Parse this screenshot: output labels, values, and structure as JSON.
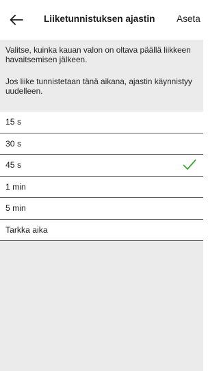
{
  "header": {
    "back_icon": "arrow-left-icon",
    "title": "Liiketunnistuksen ajastin",
    "set_label": "Aseta"
  },
  "description": {
    "line1": "Valitse, kuinka kauan valon on oltava päällä liikkeen havaitsemisen jälkeen.",
    "line2": "Jos liike tunnistetaan tänä aikana, ajastin käynnistyy uudelleen."
  },
  "options": [
    {
      "label": "15 s",
      "selected": false
    },
    {
      "label": "30 s",
      "selected": false
    },
    {
      "label": "45 s",
      "selected": true
    },
    {
      "label": "1 min",
      "selected": false
    },
    {
      "label": "5 min",
      "selected": false
    },
    {
      "label": "Tarkka aika",
      "selected": false
    }
  ],
  "colors": {
    "check": "#3aa735",
    "background_gray": "#ebebeb",
    "divider": "#5c5c5c"
  }
}
